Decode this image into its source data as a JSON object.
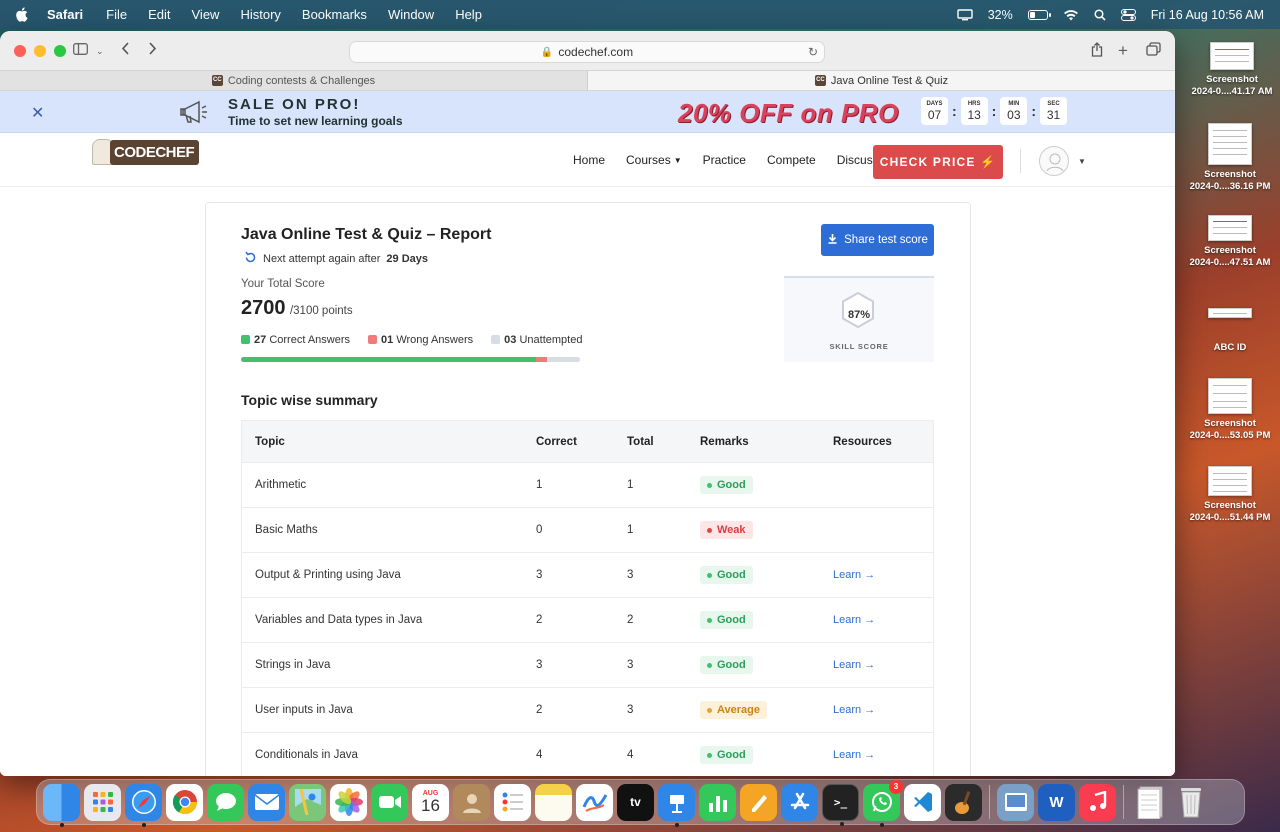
{
  "menubar": {
    "app": "Safari",
    "items": [
      "File",
      "Edit",
      "View",
      "History",
      "Bookmarks",
      "Window",
      "Help"
    ],
    "battery": "32%",
    "datetime": "Fri 16 Aug  10:56 AM"
  },
  "browser": {
    "url": "codechef.com",
    "tabs": [
      {
        "title": "Coding contests & Challenges",
        "active": false
      },
      {
        "title": "Java Online Test & Quiz",
        "active": true
      }
    ]
  },
  "promo": {
    "close": "✕",
    "headline": "SALE ON PRO!",
    "subline": "Time to set new learning goals",
    "offer": "20% OFF on PRO",
    "countdown": [
      {
        "label": "DAYS",
        "value": "07"
      },
      {
        "label": "HRS",
        "value": "13"
      },
      {
        "label": "MIN",
        "value": "03"
      },
      {
        "label": "SEC",
        "value": "31"
      }
    ]
  },
  "nav": {
    "logo": "CODECHEF",
    "links": [
      "Home",
      "Courses",
      "Practice",
      "Compete",
      "Discuss"
    ],
    "cta": "CHECK PRICE ⚡"
  },
  "report": {
    "title": "Java Online Test & Quiz – Report",
    "next_attempt_prefix": "Next attempt again after",
    "next_attempt_value": "29 Days",
    "share_label": "Share test score",
    "total_label": "Your Total Score",
    "score": "2700",
    "score_total": "/3100 points",
    "correct_count": "27",
    "correct_label": "Correct Answers",
    "wrong_count": "01",
    "wrong_label": "Wrong Answers",
    "unattempted_count": "03",
    "unattempted_label": "Unattempted",
    "progress": {
      "correct": 27,
      "wrong": 1,
      "unattempted": 3,
      "total": 31
    },
    "skill_score": "87%",
    "skill_label": "SKILL SCORE",
    "colors": {
      "correct": "#3fc16e",
      "wrong": "#f07b7b",
      "unattempted": "#d8dde5"
    }
  },
  "summary": {
    "heading": "Topic wise summary",
    "columns": [
      "Topic",
      "Correct",
      "Total",
      "Remarks",
      "Resources"
    ],
    "rows": [
      {
        "topic": "Arithmetic",
        "correct": "1",
        "total": "1",
        "remark": "Good",
        "resource": ""
      },
      {
        "topic": "Basic Maths",
        "correct": "0",
        "total": "1",
        "remark": "Weak",
        "resource": ""
      },
      {
        "topic": "Output & Printing using Java",
        "correct": "3",
        "total": "3",
        "remark": "Good",
        "resource": "Learn →"
      },
      {
        "topic": "Variables and Data types in Java",
        "correct": "2",
        "total": "2",
        "remark": "Good",
        "resource": "Learn →"
      },
      {
        "topic": "Strings in Java",
        "correct": "3",
        "total": "3",
        "remark": "Good",
        "resource": "Learn →"
      },
      {
        "topic": "User inputs in Java",
        "correct": "2",
        "total": "3",
        "remark": "Average",
        "resource": "Learn →"
      },
      {
        "topic": "Conditionals in Java",
        "correct": "4",
        "total": "4",
        "remark": "Good",
        "resource": "Learn →"
      }
    ],
    "remark_colors": {
      "Good": {
        "bg": "#e8f7ee",
        "fg": "#2f9d5a",
        "dot": "#3fc16e"
      },
      "Weak": {
        "bg": "#fde6e6",
        "fg": "#d64040",
        "dot": "#e04848"
      },
      "Average": {
        "bg": "#fdf1dc",
        "fg": "#c98412",
        "dot": "#e6a13a"
      }
    }
  },
  "desktop": [
    {
      "line1": "Screenshot",
      "line2": "2024-0....41.17 AM"
    },
    {
      "line1": "Screenshot",
      "line2": "2024-0....36.16 PM"
    },
    {
      "line1": "Screenshot",
      "line2": "2024-0....47.51 AM"
    },
    {
      "line1": "ABC ID",
      "line2": ""
    },
    {
      "line1": "Screenshot",
      "line2": "2024-0....53.05 PM"
    },
    {
      "line1": "Screenshot",
      "line2": "2024-0....51.44 PM"
    }
  ],
  "dock": {
    "calendar_month": "AUG",
    "calendar_day": "16",
    "whatsapp_badge": "3",
    "apps": [
      "finder-icon",
      "launchpad-icon",
      "safari-icon",
      "chrome-icon",
      "messages-icon",
      "mail-icon",
      "maps-icon",
      "photos-icon",
      "facetime-icon",
      "calendar-icon",
      "contacts-icon",
      "reminders-icon",
      "notes-icon",
      "freeform-icon",
      "tv-icon",
      "keynote-icon",
      "numbers-icon",
      "pages-icon",
      "app-store-icon",
      "terminal-icon",
      "whatsapp-icon",
      "vscode-icon",
      "garageband-icon",
      "preview-icon",
      "word-icon",
      "music-icon",
      "downloads-stack-icon",
      "trash-icon"
    ]
  }
}
